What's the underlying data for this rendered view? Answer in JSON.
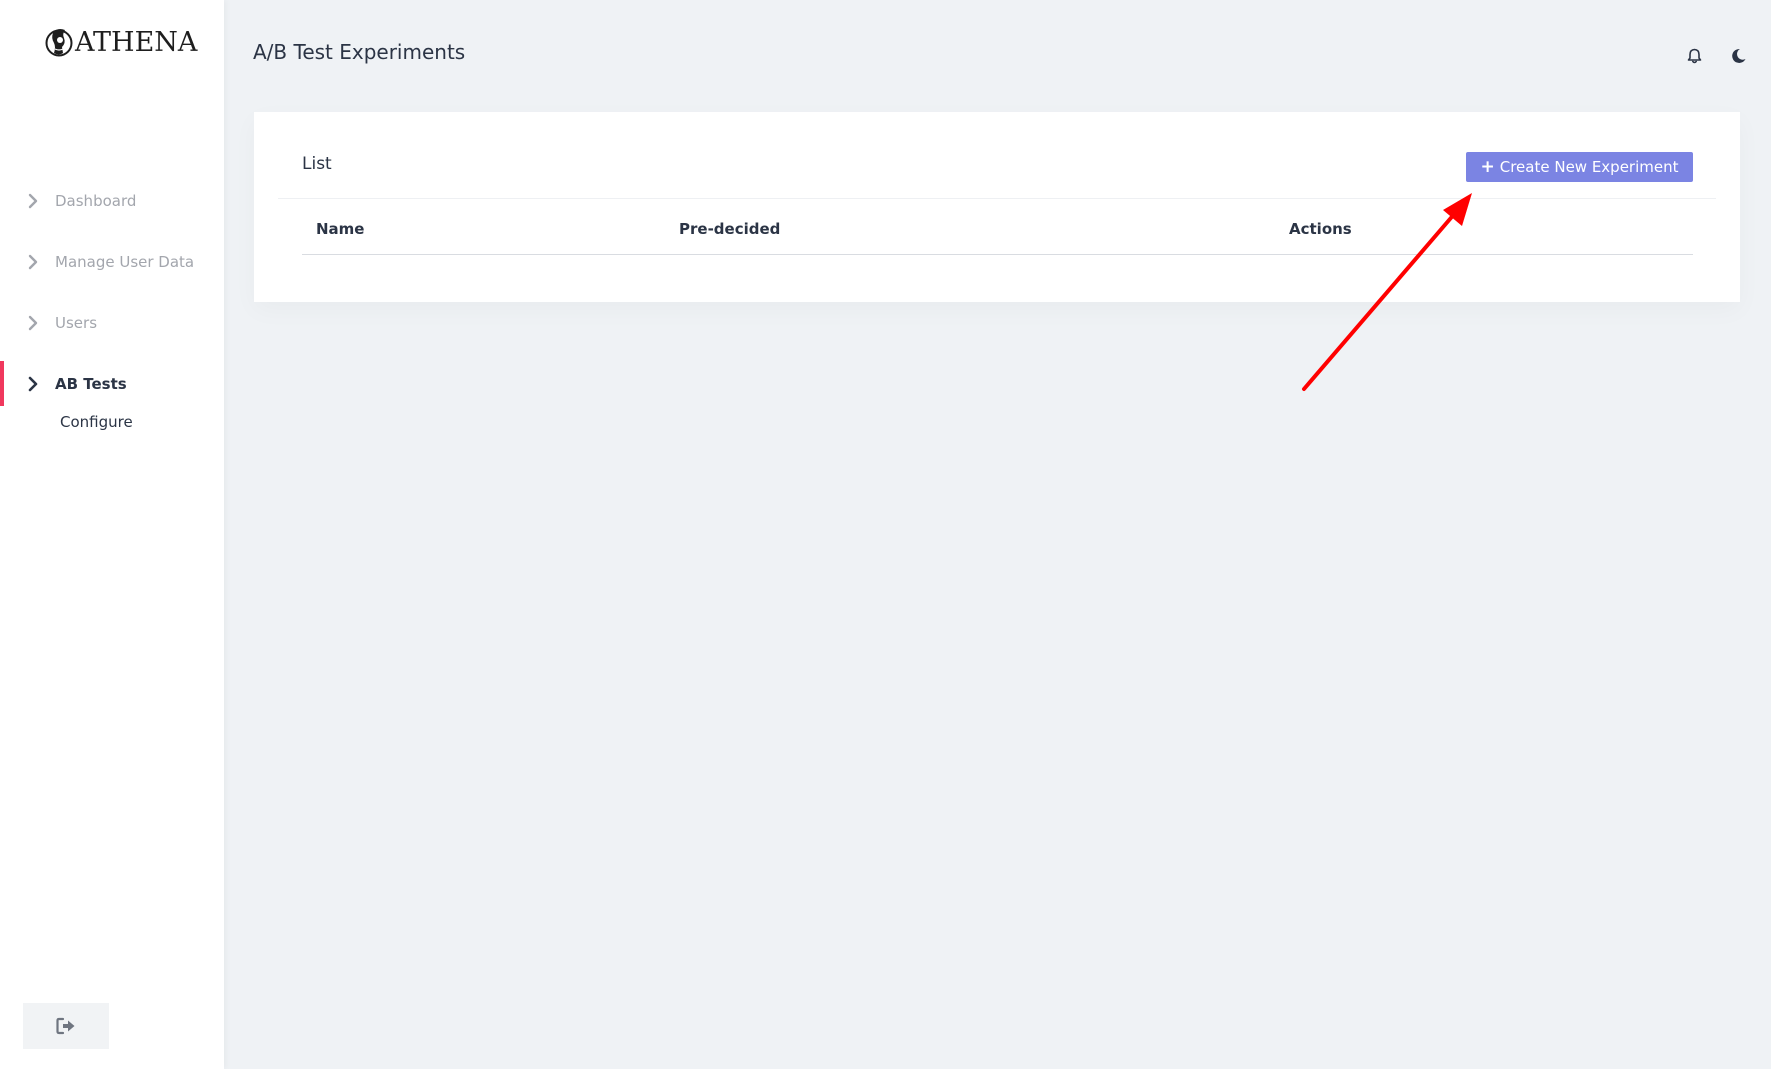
{
  "brand": {
    "logo_text": "ATHENA"
  },
  "sidebar": {
    "items": [
      {
        "label": "Dashboard",
        "active": false
      },
      {
        "label": "Manage User Data",
        "active": false
      },
      {
        "label": "Users",
        "active": false
      },
      {
        "label": "AB Tests",
        "active": true
      }
    ],
    "sub_items": [
      {
        "label": "Configure"
      }
    ],
    "logout_icon": "sign-out-icon"
  },
  "header": {
    "title": "A/B Test Experiments",
    "icons": [
      "bell-icon",
      "moon-icon"
    ]
  },
  "card": {
    "title": "List",
    "create_button": {
      "icon": "plus-icon",
      "plus": "+",
      "label": "Create New Experiment"
    },
    "table": {
      "columns": [
        "Name",
        "Pre-decided",
        "Actions"
      ],
      "rows": []
    }
  },
  "annotation": {
    "type": "arrow",
    "color": "#ff0000",
    "points_to": "create-new-experiment-button"
  },
  "colors": {
    "accent": "#7b84e3",
    "active_indicator": "#f0385d",
    "text_primary": "#2b3445",
    "text_muted": "#a3a6ad",
    "background": "#eff2f5"
  }
}
